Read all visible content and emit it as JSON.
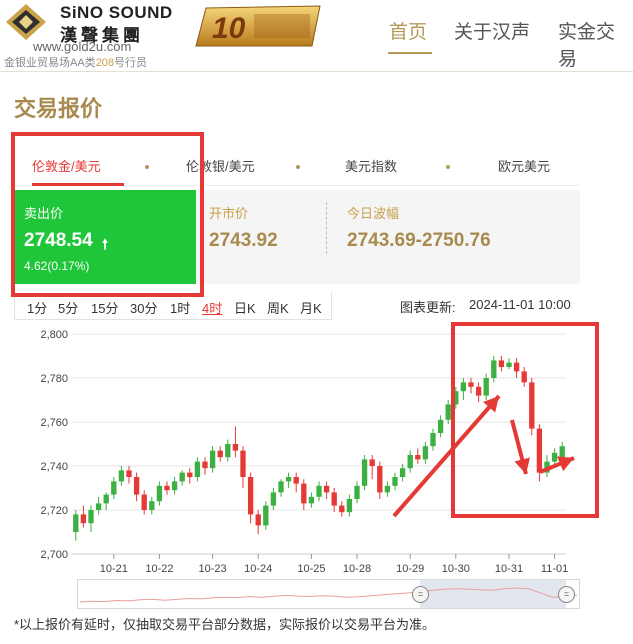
{
  "header": {
    "brand_en": "SiNO SOUND",
    "brand_cn": "漢聲集團",
    "site_url": "www.gold2u.com",
    "license_prefix": "金银业贸易场AA类",
    "license_number": "208",
    "license_suffix": "号行员",
    "nav": [
      "首页",
      "关于汉声",
      "实金交易"
    ]
  },
  "page_title": "交易报价",
  "tabs": [
    "伦敦金/美元",
    "伦敦银/美元",
    "美元指数",
    "欧元美元"
  ],
  "quote": {
    "sell_label": "卖出价",
    "sell_price": "2748.54",
    "direction_icon": "up-arrow-icon",
    "change": "4.62(0.17%)",
    "open_label": "开市价",
    "open_value": "2743.92",
    "range_label": "今日波幅",
    "range_value": "2743.69-2750.76"
  },
  "periods": [
    "1分",
    "5分",
    "15分",
    "30分",
    "1时",
    "4时",
    "日K",
    "周K",
    "月K"
  ],
  "active_period": "4时",
  "update": {
    "label": "图表更新:",
    "time": "2024-11-01 10:00"
  },
  "footnote": "*以上报价有延时，仅抽取交易平台部分数据，实际报价以交易平台为准。",
  "colors": {
    "up": "#3cb043",
    "down": "#e53935",
    "gold": "#b49a5a",
    "quote_bg": "#1fc63a"
  },
  "chart_data": {
    "type": "candlestick",
    "ylim": [
      2700,
      2800
    ],
    "yticks": [
      "2,700",
      "2,720",
      "2,740",
      "2,760",
      "2,780",
      "2,800"
    ],
    "xticks": [
      "10-21",
      "10-22",
      "10-23",
      "10-24",
      "10-25",
      "10-28",
      "10-29",
      "10-30",
      "10-31",
      "11-01"
    ],
    "candles": [
      [
        2710,
        2718,
        2706,
        2720
      ],
      [
        2718,
        2714,
        2712,
        2722
      ],
      [
        2714,
        2720,
        2710,
        2722
      ],
      [
        2720,
        2723,
        2718,
        2726
      ],
      [
        2723,
        2727,
        2720,
        2728
      ],
      [
        2727,
        2733,
        2725,
        2735
      ],
      [
        2733,
        2738,
        2731,
        2740
      ],
      [
        2738,
        2735,
        2732,
        2740
      ],
      [
        2735,
        2727,
        2724,
        2737
      ],
      [
        2727,
        2720,
        2718,
        2729
      ],
      [
        2720,
        2724,
        2718,
        2726
      ],
      [
        2724,
        2731,
        2722,
        2733
      ],
      [
        2731,
        2729,
        2727,
        2733
      ],
      [
        2729,
        2733,
        2727,
        2735
      ],
      [
        2733,
        2737,
        2731,
        2738
      ],
      [
        2737,
        2735,
        2732,
        2739
      ],
      [
        2735,
        2742,
        2733,
        2744
      ],
      [
        2742,
        2739,
        2736,
        2744
      ],
      [
        2739,
        2747,
        2737,
        2749
      ],
      [
        2747,
        2744,
        2742,
        2749
      ],
      [
        2744,
        2750,
        2742,
        2752
      ],
      [
        2750,
        2747,
        2744,
        2758
      ],
      [
        2747,
        2735,
        2730,
        2749
      ],
      [
        2735,
        2718,
        2714,
        2737
      ],
      [
        2718,
        2713,
        2709,
        2720
      ],
      [
        2713,
        2722,
        2711,
        2724
      ],
      [
        2722,
        2728,
        2720,
        2730
      ],
      [
        2728,
        2733,
        2726,
        2734
      ],
      [
        2733,
        2735,
        2730,
        2737
      ],
      [
        2735,
        2732,
        2728,
        2737
      ],
      [
        2732,
        2723,
        2720,
        2734
      ],
      [
        2723,
        2726,
        2721,
        2728
      ],
      [
        2726,
        2731,
        2724,
        2733
      ],
      [
        2731,
        2728,
        2725,
        2733
      ],
      [
        2728,
        2722,
        2719,
        2730
      ],
      [
        2722,
        2719,
        2717,
        2724
      ],
      [
        2719,
        2725,
        2717,
        2727
      ],
      [
        2725,
        2731,
        2723,
        2733
      ],
      [
        2731,
        2743,
        2729,
        2745
      ],
      [
        2743,
        2740,
        2734,
        2745
      ],
      [
        2740,
        2728,
        2725,
        2742
      ],
      [
        2728,
        2731,
        2726,
        2733
      ],
      [
        2731,
        2735,
        2729,
        2737
      ],
      [
        2735,
        2739,
        2733,
        2741
      ],
      [
        2739,
        2745,
        2737,
        2747
      ],
      [
        2745,
        2743,
        2741,
        2748
      ],
      [
        2743,
        2749,
        2741,
        2751
      ],
      [
        2749,
        2755,
        2747,
        2757
      ],
      [
        2755,
        2761,
        2753,
        2763
      ],
      [
        2761,
        2768,
        2759,
        2770
      ],
      [
        2768,
        2774,
        2766,
        2776
      ],
      [
        2774,
        2778,
        2770,
        2780
      ],
      [
        2778,
        2776,
        2773,
        2780
      ],
      [
        2776,
        2772,
        2769,
        2778
      ],
      [
        2772,
        2780,
        2770,
        2782
      ],
      [
        2780,
        2788,
        2778,
        2790
      ],
      [
        2788,
        2785,
        2783,
        2790
      ],
      [
        2785,
        2787,
        2784,
        2789
      ],
      [
        2787,
        2783,
        2780,
        2789
      ],
      [
        2783,
        2778,
        2776,
        2785
      ],
      [
        2778,
        2757,
        2754,
        2780
      ],
      [
        2757,
        2737,
        2733,
        2759
      ],
      [
        2737,
        2742,
        2735,
        2745
      ],
      [
        2742,
        2746,
        2740,
        2748
      ],
      [
        2744,
        2749,
        2743,
        2751
      ]
    ],
    "navigator_series": [
      2719,
      2722,
      2721,
      2726,
      2724,
      2729,
      2732,
      2727,
      2731,
      2735,
      2733,
      2738,
      2741,
      2739,
      2744,
      2740,
      2745,
      2749,
      2746,
      2744,
      2748,
      2745,
      2741,
      2743,
      2747,
      2752,
      2756,
      2760,
      2766,
      2772,
      2777,
      2780,
      2778,
      2775,
      2773,
      2780,
      2783,
      2780,
      2760,
      2740,
      2745,
      2749
    ]
  }
}
